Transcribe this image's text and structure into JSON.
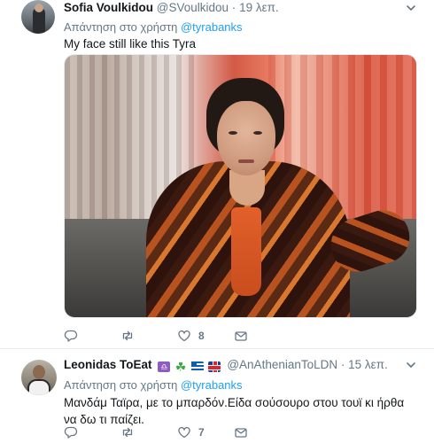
{
  "tweets": [
    {
      "name": "Sofia Voulkidou",
      "handle": "@SVoulkidou",
      "dot": "·",
      "time": "19 λεπ.",
      "reply_prefix": "Απάντηση στο χρήστη",
      "reply_to": "@tyrabanks",
      "text": "My face still like this Tyra",
      "likes": "8",
      "media_icon": "photo"
    },
    {
      "name": "Leonidas ToEat",
      "handle": "@AnAthenianToLDN",
      "dot": "·",
      "time": "15 λεπ.",
      "reply_prefix": "Απάντηση στο χρήστη",
      "reply_to": "@tyrabanks",
      "text": "Μανδάμ Ταϊρα, με το μπαρδόν.Είδα σούσουρο στου τουϊ κι ήρθα να δω τι παίζει.",
      "likes": "7",
      "emojis": [
        "libra-icon",
        "shamrock-icon",
        "greece-flag-icon",
        "uk-flag-icon"
      ]
    }
  ],
  "colors": {
    "link": "#1da1f2",
    "muted": "#657786",
    "text": "#14171a",
    "divider": "#e6ecf0"
  }
}
